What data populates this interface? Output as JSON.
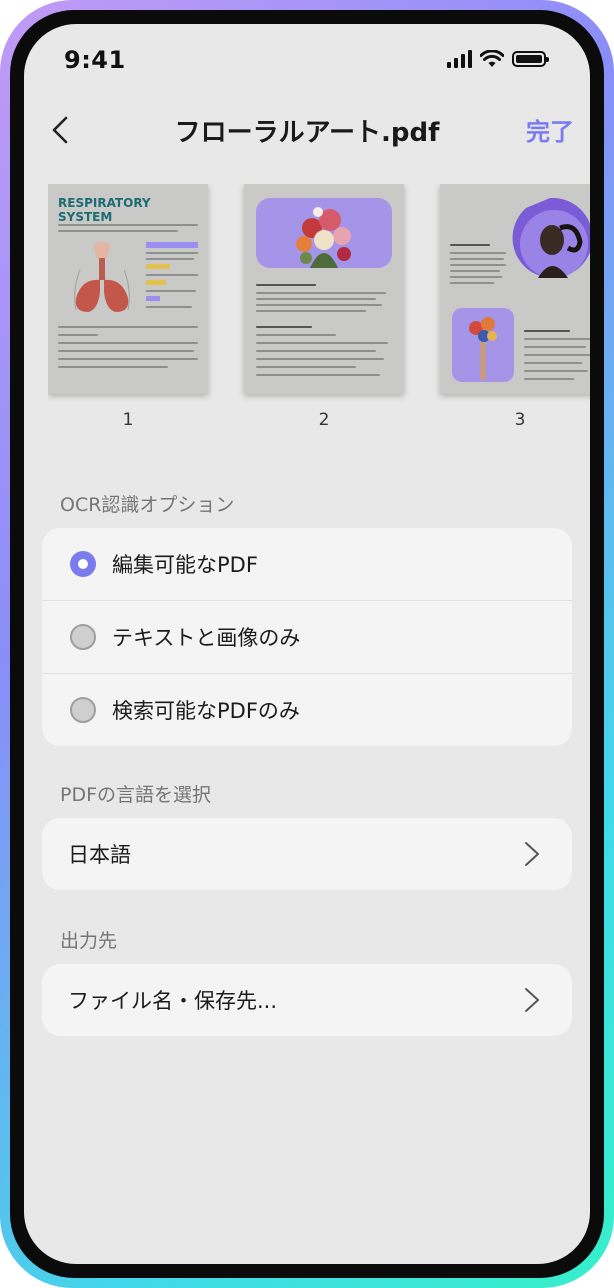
{
  "status_bar": {
    "time": "9:41"
  },
  "nav": {
    "title": "フローラルアート.pdf",
    "done_label": "完了"
  },
  "pages": [
    {
      "number": "1",
      "heading": "RESPIRATORY SYSTEM"
    },
    {
      "number": "2"
    },
    {
      "number": "3"
    }
  ],
  "ocr": {
    "section_label": "OCR認識オプション",
    "options": [
      {
        "label": "編集可能なPDF",
        "selected": true
      },
      {
        "label": "テキストと画像のみ",
        "selected": false
      },
      {
        "label": "検索可能なPDFのみ",
        "selected": false
      }
    ]
  },
  "language": {
    "section_label": "PDFの言語を選択",
    "value": "日本語"
  },
  "output": {
    "section_label": "出力先",
    "value": "ファイル名・保存先..."
  },
  "colors": {
    "accent": "#7b7bf0",
    "background": "#e8e8e8",
    "card": "#f4f4f4"
  }
}
